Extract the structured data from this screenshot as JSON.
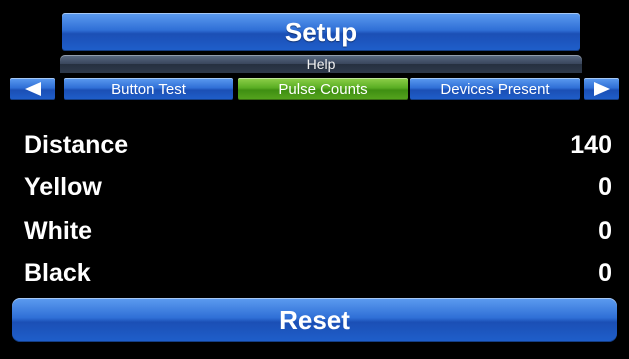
{
  "header": {
    "title": "Setup",
    "help_label": "Help"
  },
  "tabs": {
    "prev_icon": "arrow-left-icon",
    "next_icon": "arrow-right-icon",
    "items": [
      {
        "label": "Button Test",
        "active": false
      },
      {
        "label": "Pulse Counts",
        "active": true
      },
      {
        "label": "Devices Present",
        "active": false
      }
    ]
  },
  "counts": [
    {
      "label": "Distance",
      "value": "140"
    },
    {
      "label": "Yellow",
      "value": "0"
    },
    {
      "label": "White",
      "value": "0"
    },
    {
      "label": "Black",
      "value": "0"
    }
  ],
  "reset_label": "Reset",
  "colors": {
    "background": "#000000",
    "bar_blue": "#2f6fd6",
    "active_tab_green": "#59ad22",
    "help_bar": "#39465c",
    "text": "#ffffff"
  }
}
